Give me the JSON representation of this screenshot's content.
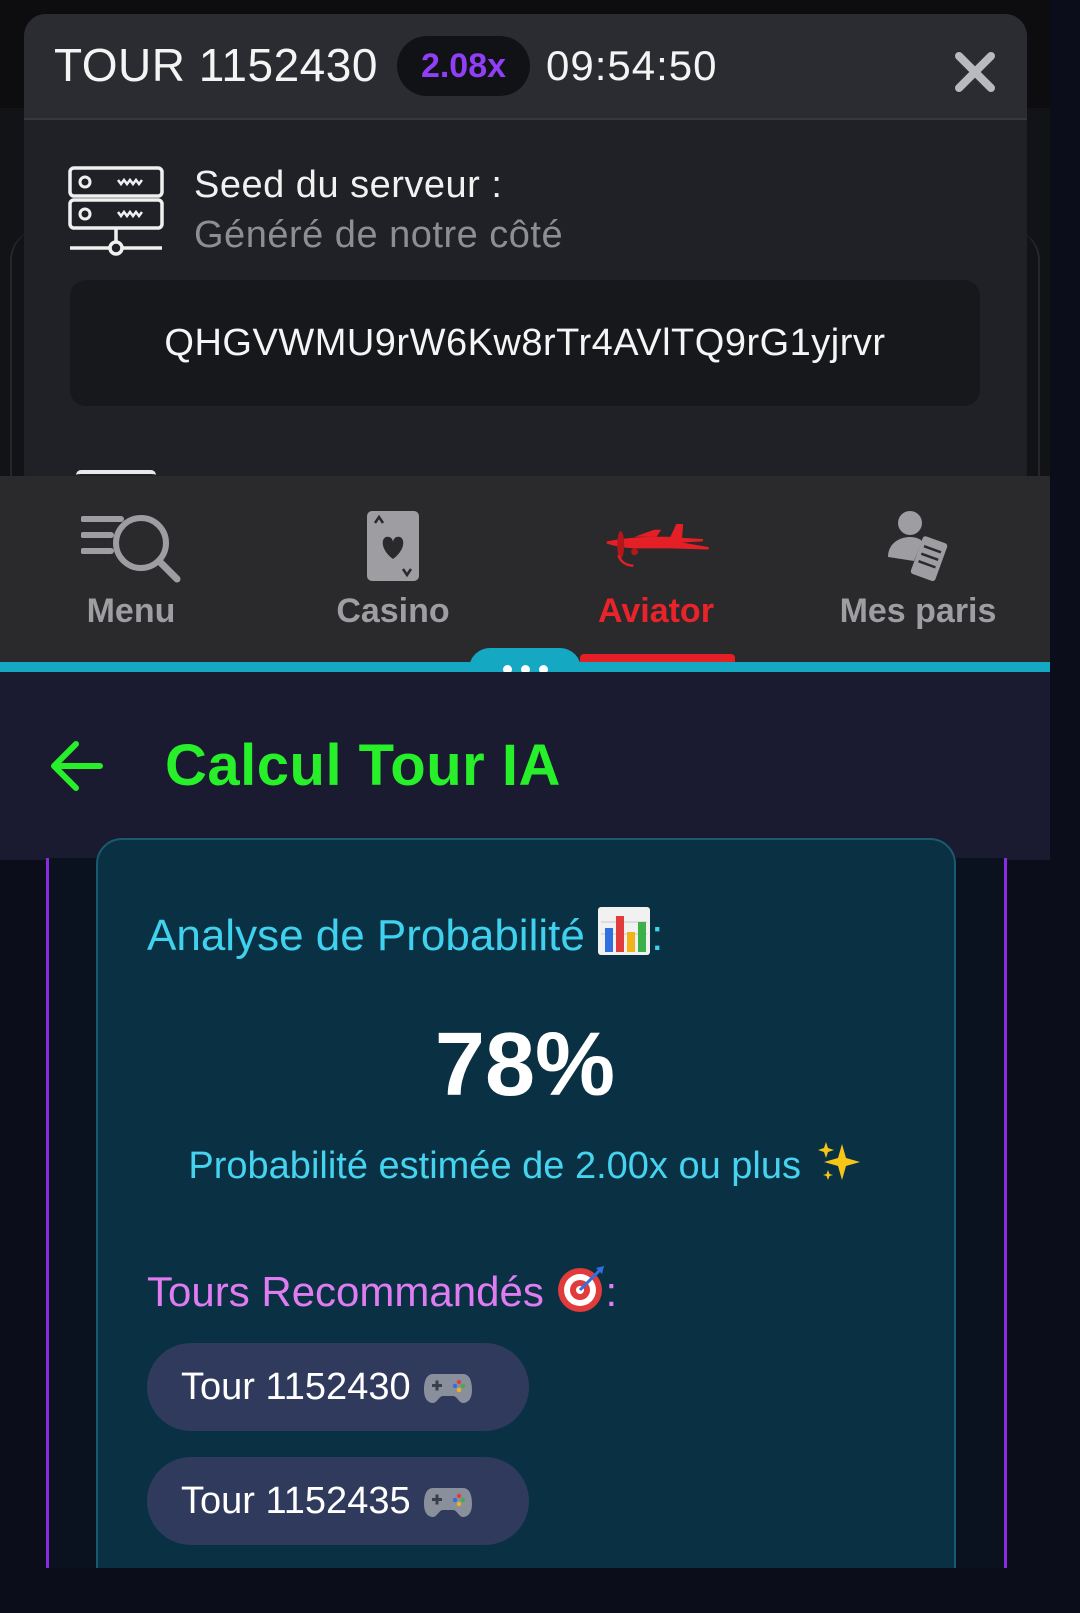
{
  "modal": {
    "round_title": "TOUR 1152430",
    "multiplier": "2.08x",
    "time": "09:54:50",
    "server_seed_label": "Seed du serveur :",
    "server_seed_sub": "Généré de notre côté",
    "server_seed_value": "QHGVWMU9rW6Kw8rTr4AVlTQ9rG1yjrvr"
  },
  "nav": {
    "items": [
      {
        "label": "Menu",
        "icon": "menu-search-icon",
        "active": false
      },
      {
        "label": "Casino",
        "icon": "playing-card-icon",
        "active": false
      },
      {
        "label": "Aviator",
        "icon": "airplane-icon",
        "active": true
      },
      {
        "label": "Mes paris",
        "icon": "user-ticket-icon",
        "active": false
      }
    ],
    "active_color": "#e51f26"
  },
  "app": {
    "title": "Calcul Tour IA",
    "title_color": "#27ef2a"
  },
  "analysis": {
    "heading": "Analyse de Probabilité",
    "heading_suffix": ":",
    "probability": "78%",
    "note": "Probabilité estimée de 2.00x ou plus",
    "tours_heading": "Tours Recommandés",
    "tours_heading_suffix": ":",
    "tours": [
      "Tour 1152430",
      "Tour 1152435"
    ]
  },
  "colors": {
    "accent_teal": "#14a8c3",
    "multiplier_purple": "#913ef8",
    "frame_purple": "#8a2be2"
  }
}
